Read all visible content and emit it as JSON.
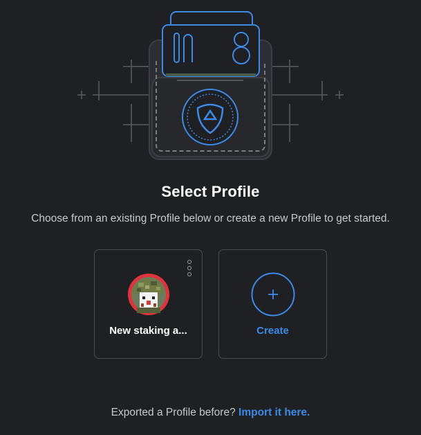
{
  "header": {
    "title": "Select Profile",
    "subtitle": "Choose from an existing Profile below or create a new Profile to get started."
  },
  "profiles": [
    {
      "name": "New staking a...",
      "avatar": "pixel-soldier-avatar"
    }
  ],
  "create": {
    "label": "Create",
    "icon": "plus-icon"
  },
  "footer": {
    "text": "Exported a Profile before?",
    "link": "Import it here."
  },
  "colors": {
    "background": "#1f2023",
    "accent": "#3d8ae6",
    "card_border": "#4a4c52",
    "avatar_ring": "#e0343c"
  }
}
